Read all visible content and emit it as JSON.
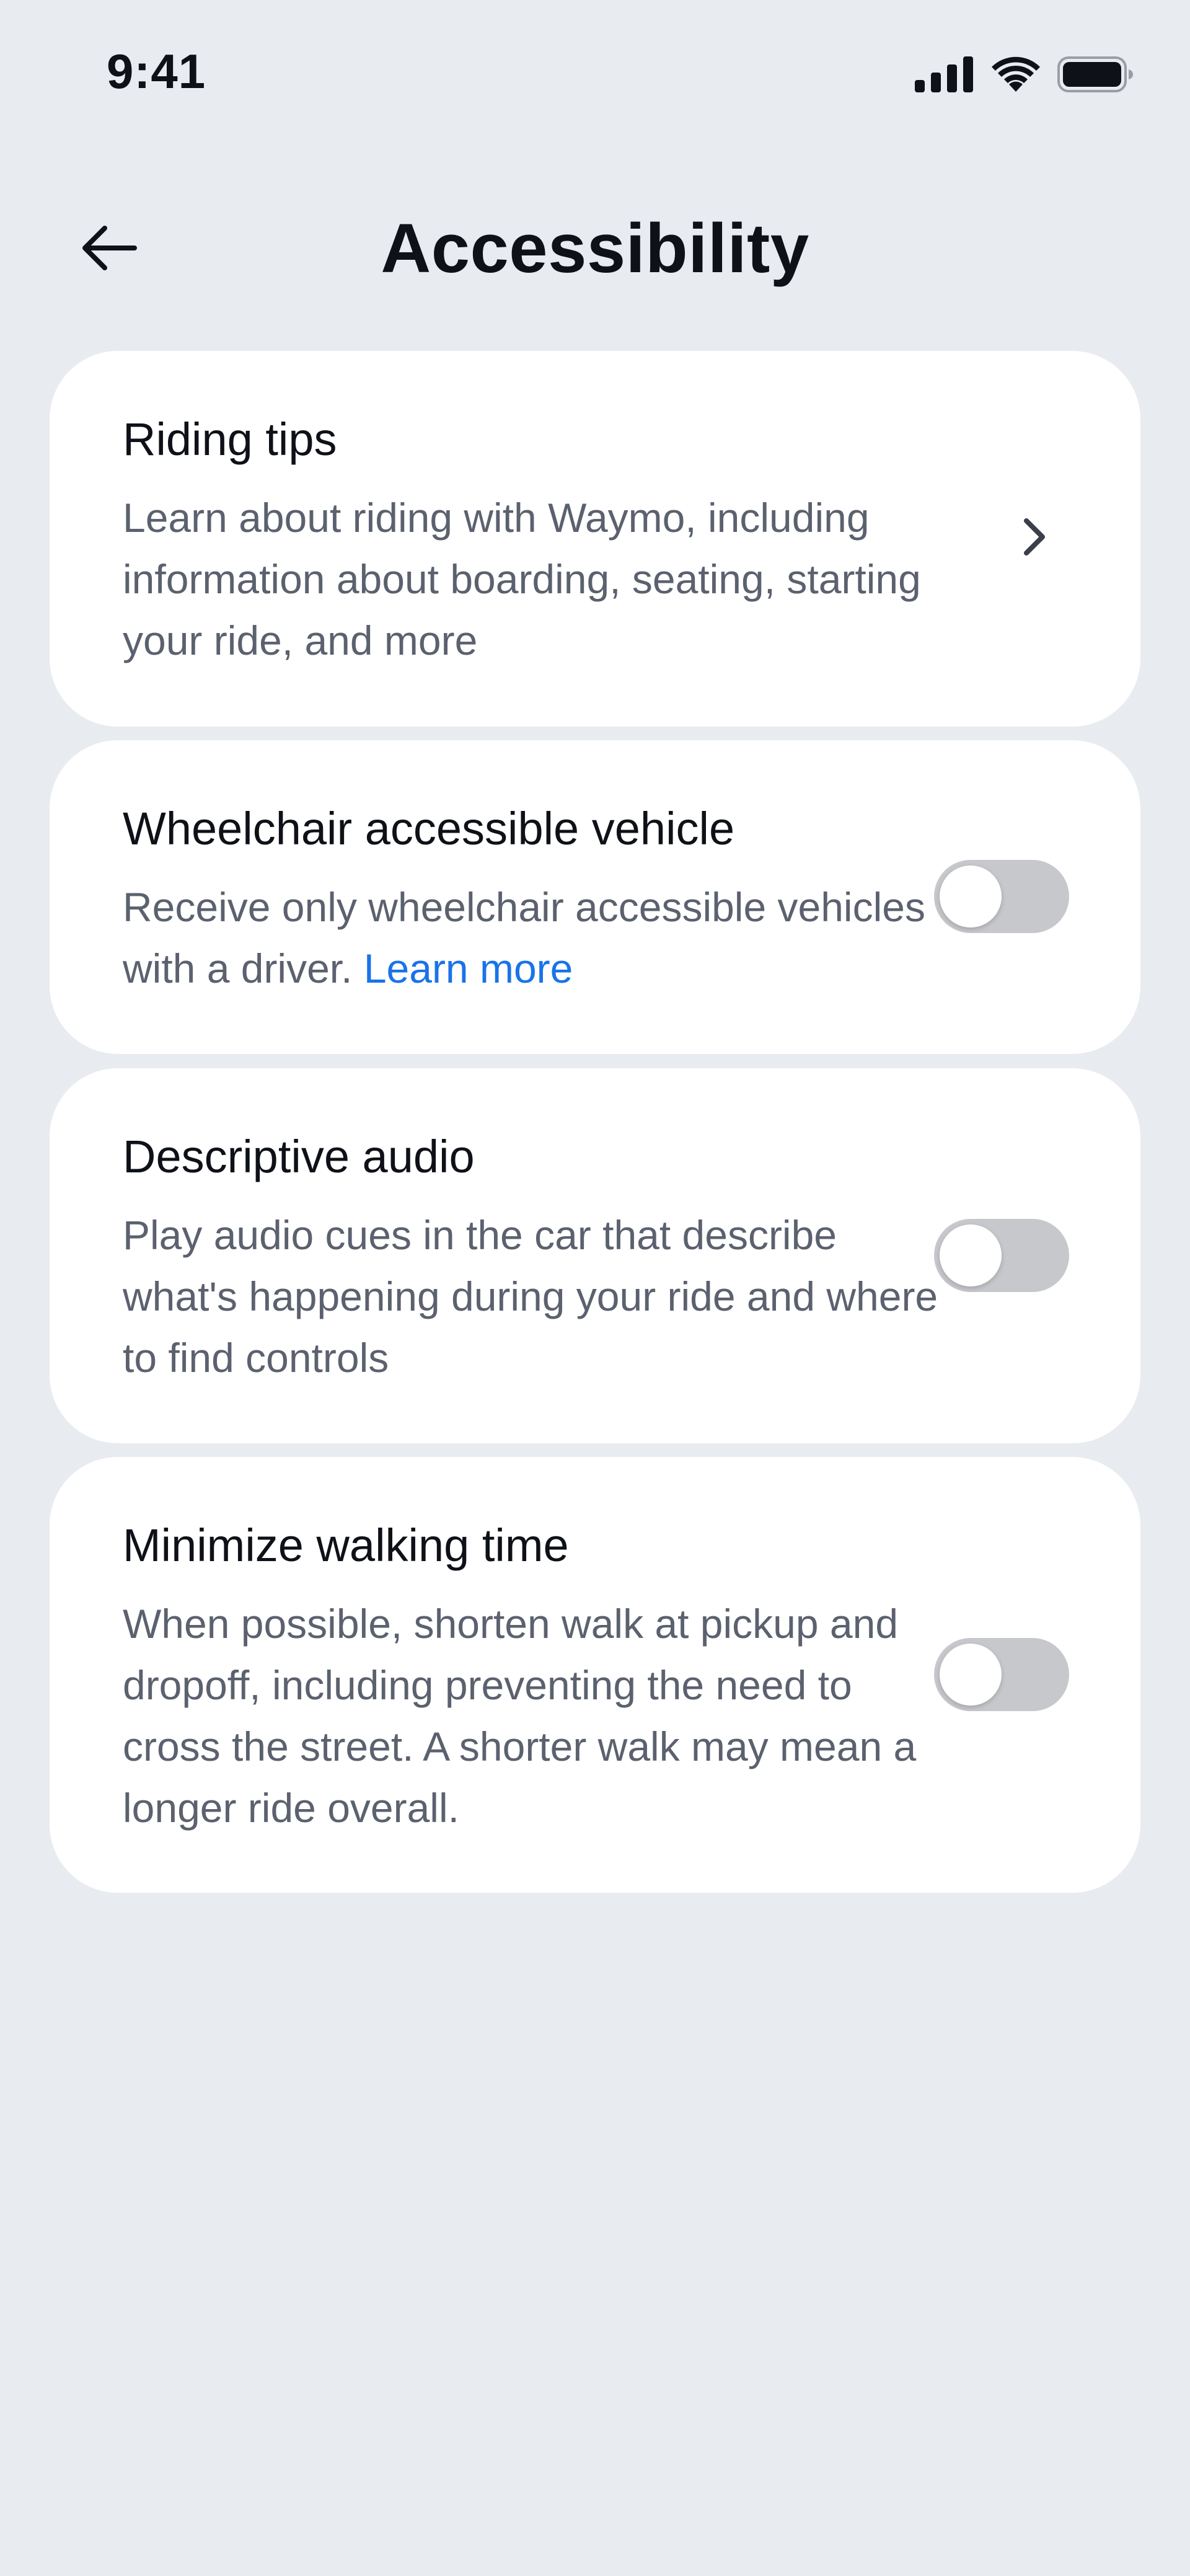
{
  "status_bar": {
    "time": "9:41",
    "icons": [
      "signal-icon",
      "wifi-icon",
      "battery-icon"
    ]
  },
  "header": {
    "title": "Accessibility",
    "back_icon": "arrow-left-icon"
  },
  "settings": [
    {
      "title": "Riding tips",
      "description": "Learn about riding with Waymo, including information about boarding, seating, starting your ride, and more",
      "control": "chevron-right-icon"
    },
    {
      "title": "Wheelchair accessible vehicle",
      "description": "Receive only wheelchair accessible vehicles with a driver.",
      "link": "Learn more",
      "control": "toggle",
      "enabled": false
    },
    {
      "title": "Descriptive audio",
      "description": "Play audio cues in the car that describe what's happening during your ride and where to find controls",
      "control": "toggle",
      "enabled": false
    },
    {
      "title": "Minimize walking time",
      "description": "When possible, shorten walk at pickup and dropoff, including preventing the need to cross the street. A shorter walk may mean a longer ride overall.",
      "control": "toggle",
      "enabled": false
    }
  ],
  "colors": {
    "background": "#e8ebf0",
    "card": "#ffffff",
    "title_text": "#0e1117",
    "body_text": "#5b616e",
    "link": "#1a73e8",
    "toggle_off": "#c6c8cc"
  }
}
